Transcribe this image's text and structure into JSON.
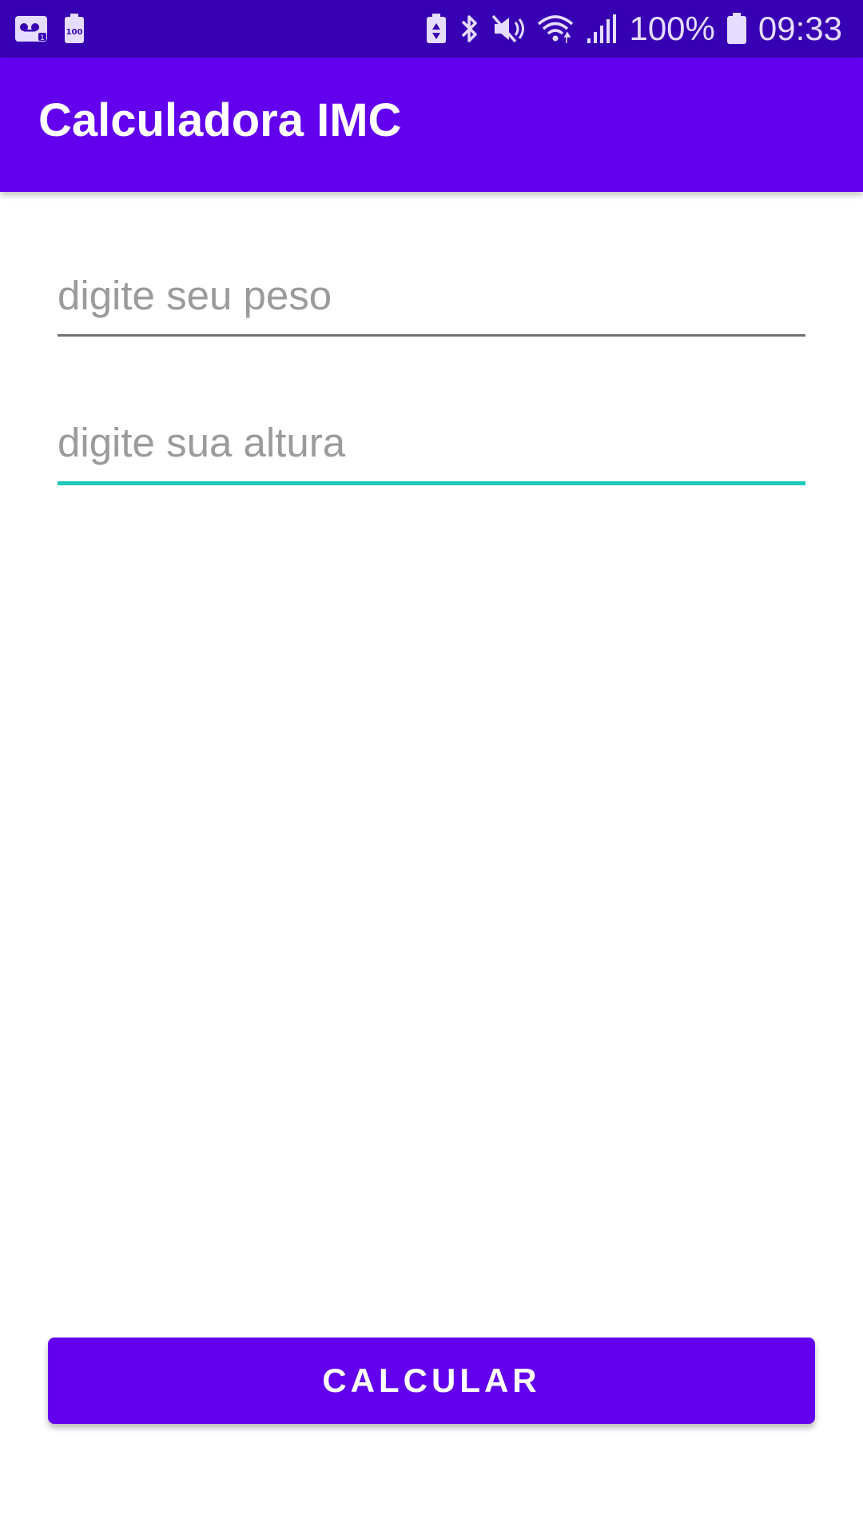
{
  "status_bar": {
    "left_icons": [
      "voicemail-icon",
      "battery-100-icon"
    ],
    "right_icons": [
      "battery-saver-icon",
      "bluetooth-icon",
      "mute-icon",
      "wifi-icon",
      "signal-icon",
      "battery-icon"
    ],
    "battery_percent": "100%",
    "time": "09:33",
    "small_battery_label": "100"
  },
  "app_bar": {
    "title": "Calculadora IMC"
  },
  "form": {
    "weight_placeholder": "digite seu peso",
    "height_placeholder": "digite sua altura"
  },
  "actions": {
    "calculate_label": "CALCULAR"
  },
  "colors": {
    "status_bar": "#3700B3",
    "primary": "#6200EE",
    "accent": "#1FC9B9"
  }
}
